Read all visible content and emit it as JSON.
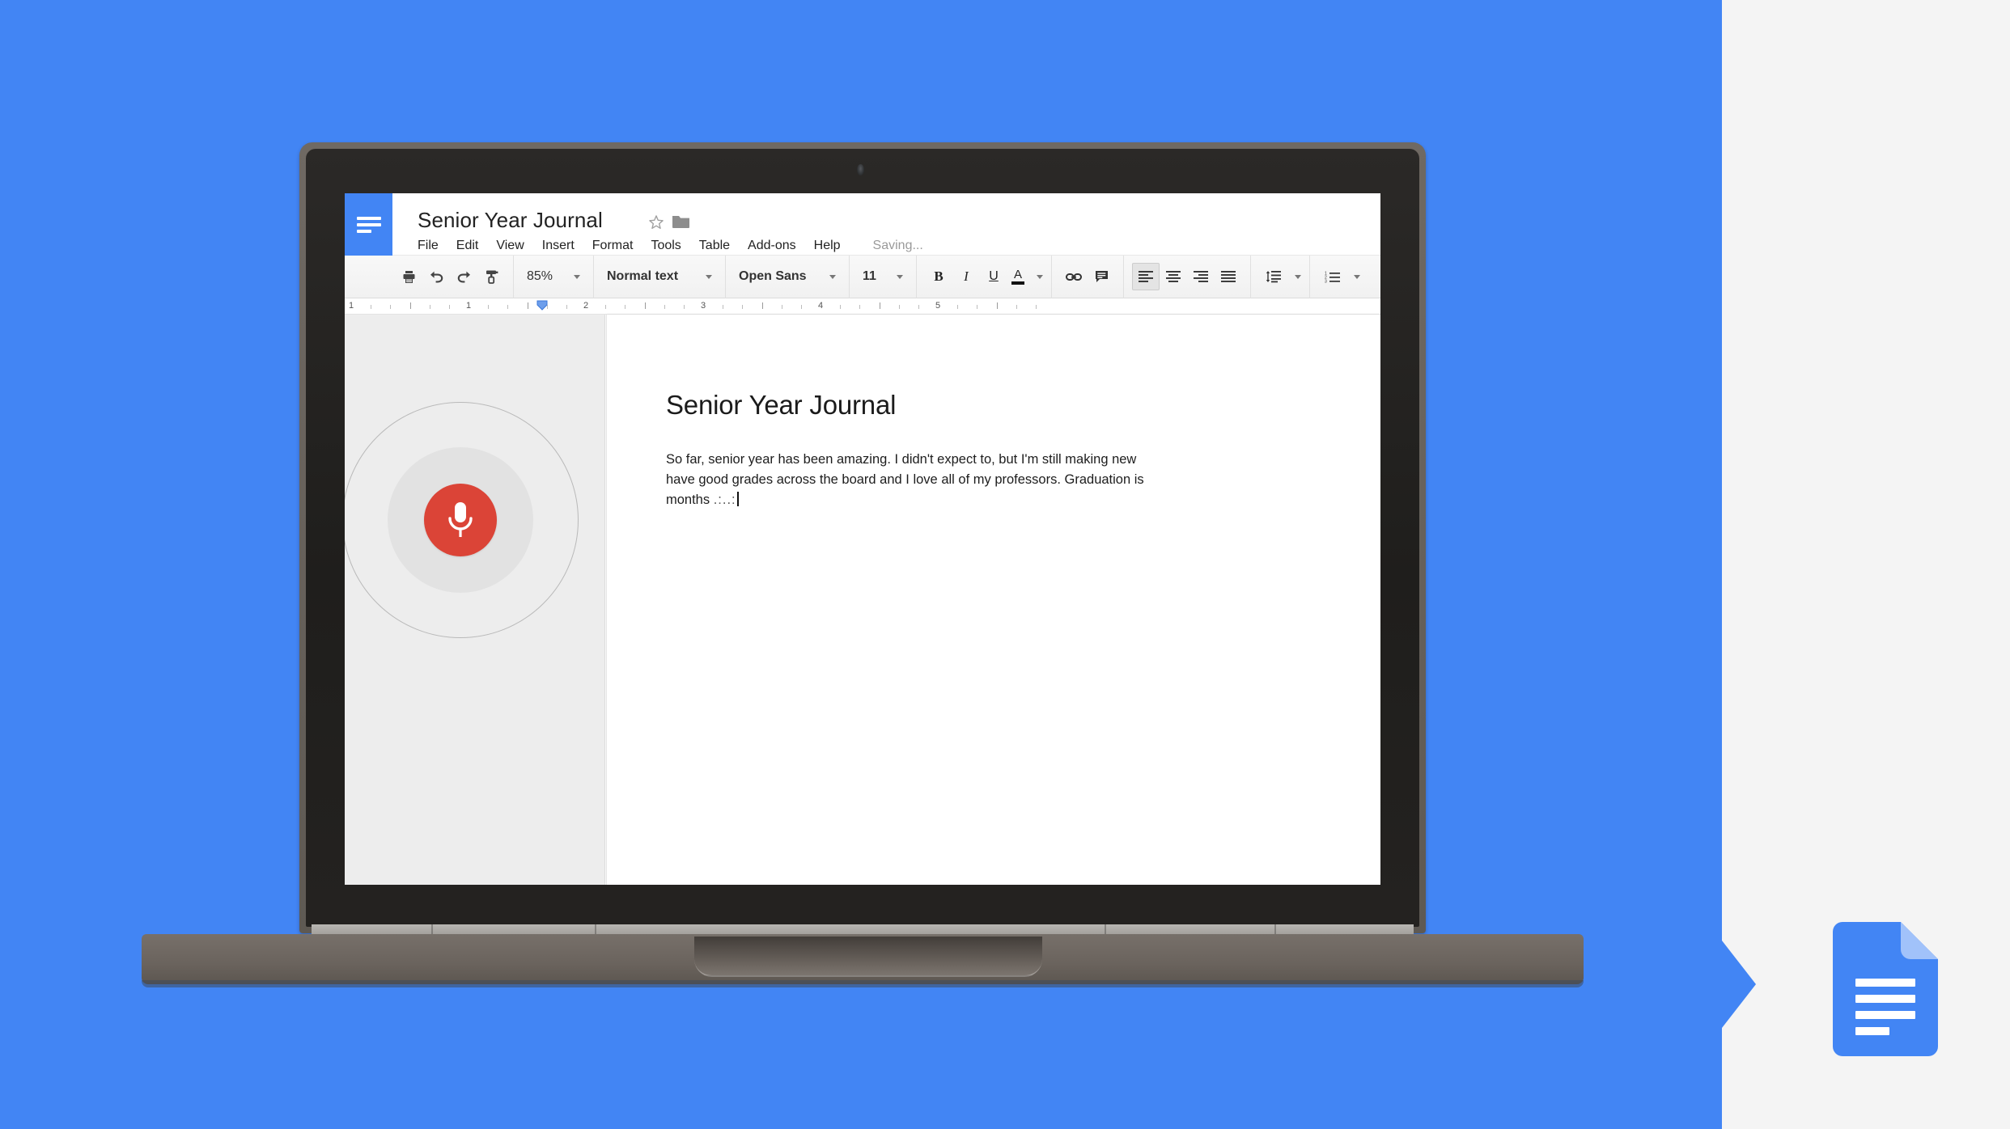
{
  "colors": {
    "brand_blue": "#4285F4",
    "right_panel_bg": "#F4F4F4",
    "mic_red": "#DB4437",
    "voice_panel_bg": "#EDEDED",
    "saving_text": "#9A9A9A"
  },
  "app": {
    "logo_icon": "docs-logo-icon",
    "document_title": "Senior Year Journal",
    "star_icon": "star-icon",
    "folder_icon": "folder-icon",
    "menus": [
      "File",
      "Edit",
      "View",
      "Insert",
      "Format",
      "Tools",
      "Table",
      "Add-ons",
      "Help"
    ],
    "save_status": "Saving..."
  },
  "toolbar": {
    "print_icon": "print-icon",
    "undo_icon": "undo-icon",
    "redo_icon": "redo-icon",
    "paint_format_icon": "paint-format-icon",
    "zoom_value": "85%",
    "style_value": "Normal text",
    "font_value": "Open Sans",
    "font_size_value": "11",
    "bold_label": "B",
    "italic_label": "I",
    "underline_label": "U",
    "text_color_label": "A",
    "link_icon": "link-icon",
    "comment_icon": "comment-icon",
    "align_left_icon": "align-left-icon",
    "align_center_icon": "align-center-icon",
    "align_right_icon": "align-right-icon",
    "align_justify_icon": "align-justify-icon",
    "line_spacing_icon": "line-spacing-icon",
    "numbered_list_icon": "numbered-list-icon"
  },
  "ruler": {
    "numbers": [
      "1",
      "1",
      "2",
      "3",
      "4",
      "5"
    ],
    "indent_marker_icon": "indent-marker-icon"
  },
  "voice_panel": {
    "mic_icon": "microphone-icon",
    "outer_ring_icon": "pulse-ring-outer",
    "mid_ring_icon": "pulse-ring-mid"
  },
  "document": {
    "heading": "Senior Year Journal",
    "body_lines": [
      "So far, senior year has been amazing. I didn't expect to, but I'm still making new",
      "have good grades across the board and I love all of my professors. Graduation is",
      "months"
    ],
    "trailing_dots": ".:..:"
  },
  "decor": {
    "arrow_icon": "right-arrow-icon",
    "docs_product_icon": "google-docs-product-icon",
    "webcam_icon": "webcam-icon"
  }
}
